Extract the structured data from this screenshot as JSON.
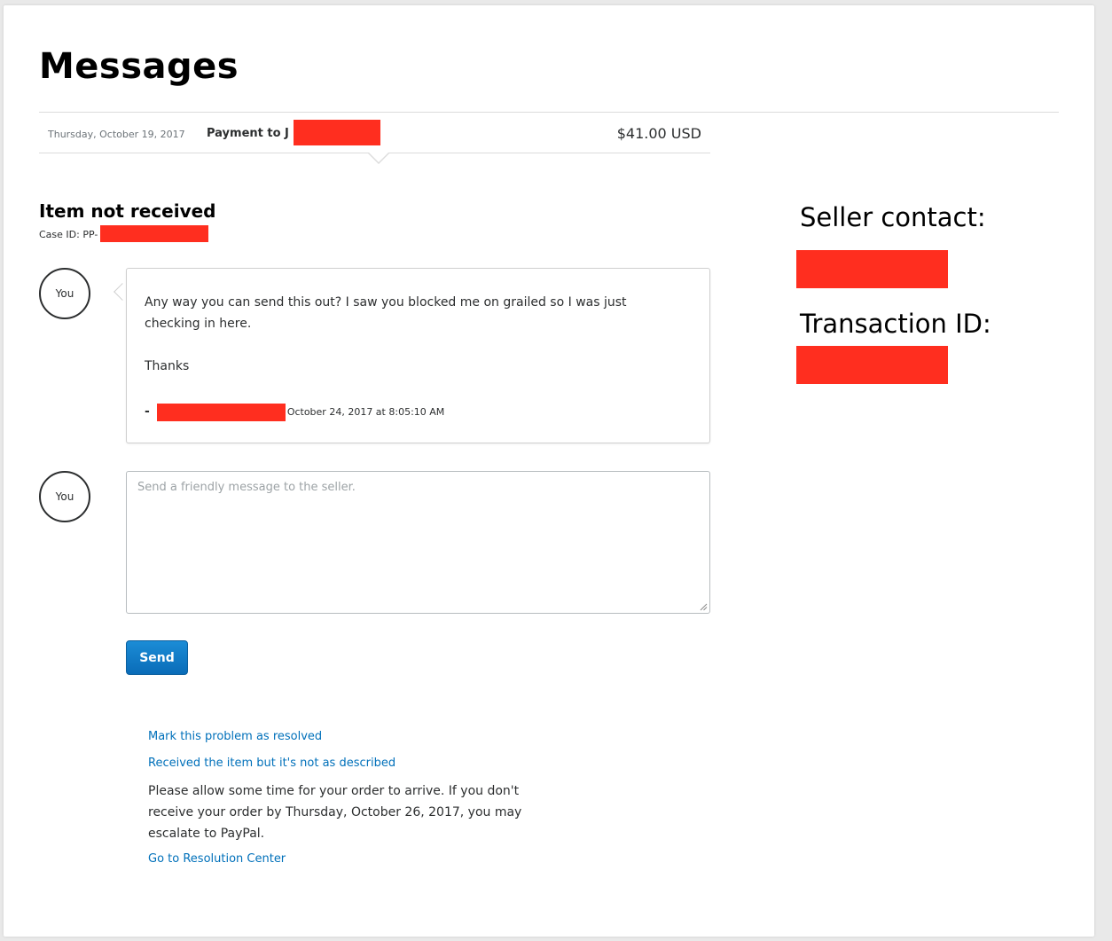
{
  "page": {
    "title": "Messages"
  },
  "transaction": {
    "date": "Thursday, October 19, 2017",
    "description": "Payment to J",
    "amount": "$41.00 USD"
  },
  "case": {
    "title": "Item not received",
    "id_label": "Case ID: PP-"
  },
  "message": {
    "author": "You",
    "body": "Any way you can send this out? I saw you blocked me on grailed so I was just checking in here.",
    "closing": "Thanks",
    "signature_dash": "-",
    "timestamp": "October 24, 2017 at 8:05:10 AM"
  },
  "reply": {
    "author": "You",
    "placeholder": "Send a friendly message to the seller.",
    "send_label": "Send"
  },
  "links": {
    "mark_resolved": "Mark this problem as resolved",
    "not_as_described": "Received the item but it's not as described",
    "resolution_center": "Go to Resolution Center"
  },
  "notice": "Please allow some time for your order to arrive. If you don't receive your order by Thursday, October 26, 2017, you may escalate to PayPal.",
  "sidebar": {
    "seller_contact_label": "Seller contact:",
    "transaction_id_label": "Transaction ID:"
  },
  "colors": {
    "redaction": "#ff2e1f",
    "link": "#0070ba",
    "button": "#0a6cb8"
  }
}
